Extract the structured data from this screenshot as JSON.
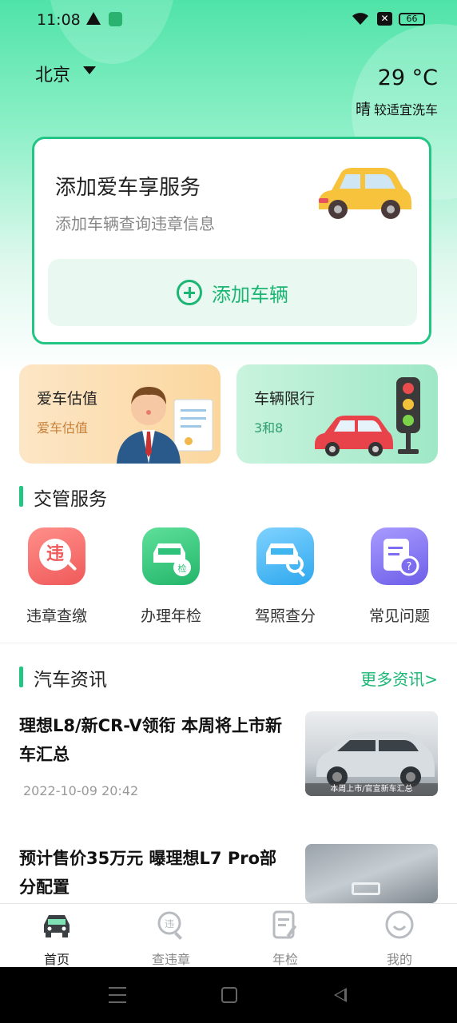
{
  "status_bar": {
    "time": "11:08",
    "battery": "66"
  },
  "header": {
    "city": "北京",
    "temperature": "29 °C",
    "weather_condition": "晴",
    "car_wash_tip": "较适宜洗车"
  },
  "add_card": {
    "title": "添加爱车享服务",
    "subtitle": "添加车辆查询违章信息",
    "button_label": "添加车辆"
  },
  "quick_cards": [
    {
      "title": "爱车估值",
      "subtitle": "爱车估值"
    },
    {
      "title": "车辆限行",
      "subtitle": "3和8"
    }
  ],
  "traffic_services": {
    "section_title": "交管服务",
    "items": [
      {
        "label": "违章查缴",
        "icon": "violation-icon",
        "color": "#f26c6c"
      },
      {
        "label": "办理年检",
        "icon": "annual-inspection-icon",
        "color": "#2fc27a"
      },
      {
        "label": "驾照查分",
        "icon": "license-points-icon",
        "color": "#3fb6f0"
      },
      {
        "label": "常见问题",
        "icon": "faq-icon",
        "color": "#7b6cf0"
      }
    ]
  },
  "news": {
    "section_title": "汽车资讯",
    "more_label": "更多资讯>",
    "items": [
      {
        "title": "理想L8/新CR-V领衔 本周将上市新车汇总",
        "time": "2022-10-09 20:42",
        "image_caption": "本周上市/官宣新车汇总"
      },
      {
        "title": "预计售价35万元 曝理想L7 Pro部分配置",
        "time": ""
      }
    ]
  },
  "tabbar": [
    {
      "label": "首页",
      "icon": "home-car-icon",
      "active": true
    },
    {
      "label": "查违章",
      "icon": "violation-search-icon",
      "active": false
    },
    {
      "label": "年检",
      "icon": "inspection-doc-icon",
      "active": false
    },
    {
      "label": "我的",
      "icon": "profile-icon",
      "active": false
    }
  ],
  "colors": {
    "brand_green": "#22c584",
    "text_green": "#1bb673"
  }
}
